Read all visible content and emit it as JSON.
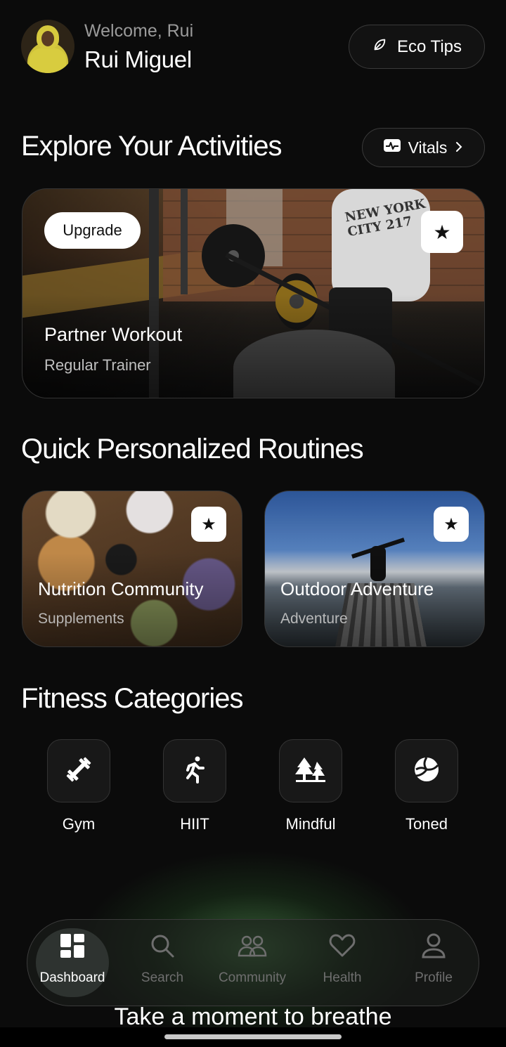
{
  "header": {
    "welcome": "Welcome, Rui",
    "name": "Rui Miguel",
    "eco_button": "Eco Tips"
  },
  "activities": {
    "title": "Explore Your Activities",
    "vitals_button": "Vitals",
    "hero": {
      "badge": "Upgrade",
      "title": "Partner Workout",
      "subtitle": "Regular Trainer"
    }
  },
  "routines": {
    "title": "Quick Personalized Routines",
    "cards": [
      {
        "title": "Nutrition Community",
        "subtitle": "Supplements"
      },
      {
        "title": "Outdoor Adventure",
        "subtitle": "Adventure"
      }
    ]
  },
  "categories": {
    "title": "Fitness Categories",
    "items": [
      {
        "label": "Gym",
        "icon": "dumbbell-icon"
      },
      {
        "label": "HIIT",
        "icon": "running-icon"
      },
      {
        "label": "Mindful",
        "icon": "trees-icon"
      },
      {
        "label": "Toned",
        "icon": "volleyball-icon"
      }
    ]
  },
  "nav": {
    "items": [
      {
        "label": "Dashboard",
        "icon": "dashboard-icon",
        "active": true
      },
      {
        "label": "Search",
        "icon": "search-icon"
      },
      {
        "label": "Community",
        "icon": "community-icon"
      },
      {
        "label": "Health",
        "icon": "heart-icon"
      },
      {
        "label": "Profile",
        "icon": "profile-icon"
      }
    ]
  },
  "breathe_text": "Take a moment to breathe",
  "colors": {
    "background": "#0b0b0b",
    "accent_glow": "#6ec86e",
    "text_secondary": "#9a9a9a"
  }
}
